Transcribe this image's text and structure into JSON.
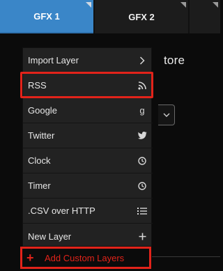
{
  "tabs": [
    {
      "label": "GFX 1",
      "active": true
    },
    {
      "label": "GFX 2",
      "active": false
    },
    {
      "label": "",
      "active": false
    }
  ],
  "background": {
    "partial_title": "tore",
    "select_chevron": "⌄"
  },
  "menu": {
    "items": [
      {
        "label": "Import Layer",
        "icon": "chevron-right-icon",
        "glyph": "›"
      },
      {
        "label": "RSS",
        "icon": "rss-icon",
        "glyph": ""
      },
      {
        "label": "Google",
        "icon": "google-icon",
        "glyph": "g"
      },
      {
        "label": "Twitter",
        "icon": "twitter-icon",
        "glyph": ""
      },
      {
        "label": "Clock",
        "icon": "clock-icon",
        "glyph": ""
      },
      {
        "label": "Timer",
        "icon": "timer-icon",
        "glyph": ""
      },
      {
        "label": ".CSV over HTTP",
        "icon": "list-icon",
        "glyph": ""
      },
      {
        "label": "New Layer",
        "icon": "plus-icon",
        "glyph": "+"
      }
    ],
    "highlighted_item": "RSS"
  },
  "add_custom_layers": {
    "plus": "+",
    "label": "Add Custom Layers"
  },
  "colors": {
    "accent": "#3a86c8",
    "highlight": "#e2231a",
    "menu_bg": "#222222"
  }
}
